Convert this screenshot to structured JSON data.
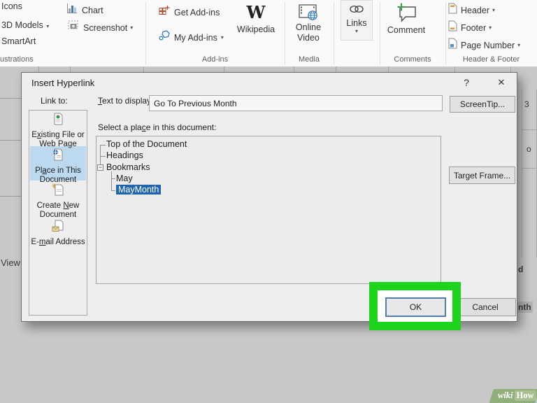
{
  "ribbon": {
    "dropdown_glyph": "▾",
    "illustrations": {
      "icons": "Icons",
      "models": "3D Models",
      "smartart": "SmartArt",
      "chart": "Chart",
      "screenshot": "Screenshot",
      "group": "ustrations"
    },
    "addins": {
      "get": "Get Add-ins",
      "my": "My Add-ins",
      "wikipedia": "Wikipedia",
      "group": "Add-ins"
    },
    "media": {
      "online": "Online",
      "video": "Video",
      "group": "Media"
    },
    "links": {
      "label": "Links"
    },
    "comments": {
      "comment": "Comment",
      "group": "Comments"
    },
    "header_footer": {
      "header": "Header",
      "footer": "Footer",
      "page_number": "Page Number",
      "group": "Header & Footer"
    }
  },
  "background": {
    "view": "View",
    "fragment_3": "3",
    "fragment_o": "o",
    "fragment_d": "d",
    "fragment_nth": "nth"
  },
  "dialog": {
    "title": "Insert Hyperlink",
    "help": "?",
    "close": "✕",
    "link_to": "Link to:",
    "text_to_display": {
      "pre": "",
      "key": "T",
      "post": "ext to display:"
    },
    "display_value": "Go To Previous Month",
    "screentip": "ScreenTip...",
    "sidebar": [
      {
        "pre": "E",
        "key": "x",
        "post": "isting File or Web Page",
        "selected": false
      },
      {
        "pre": "Pl",
        "key": "a",
        "post": "ce in This Document",
        "selected": true
      },
      {
        "pre": "Create ",
        "key": "N",
        "post": "ew Document",
        "selected": false
      },
      {
        "pre": "E-",
        "key": "m",
        "post": "ail Address",
        "selected": false
      }
    ],
    "select_place": {
      "pre": "Select a pla",
      "key": "c",
      "post": "e in this document:"
    },
    "tree": {
      "root": "Top of the Document",
      "headings": "Headings",
      "bookmarks": "Bookmarks",
      "collapse_glyph": "−",
      "children": [
        "May",
        "MayMonth"
      ],
      "selected": "MayMonth"
    },
    "target_frame": "Target Frame...",
    "ok": "OK",
    "cancel": "Cancel"
  },
  "watermark": {
    "wiki": "wiki",
    "how": "How"
  },
  "colors": {
    "annotation_green": "#1bd41b",
    "tree_selection_blue": "#1f64ad",
    "sidebar_selection_blue": "#bcd9f0",
    "dialog_gray": "#efeeee"
  }
}
